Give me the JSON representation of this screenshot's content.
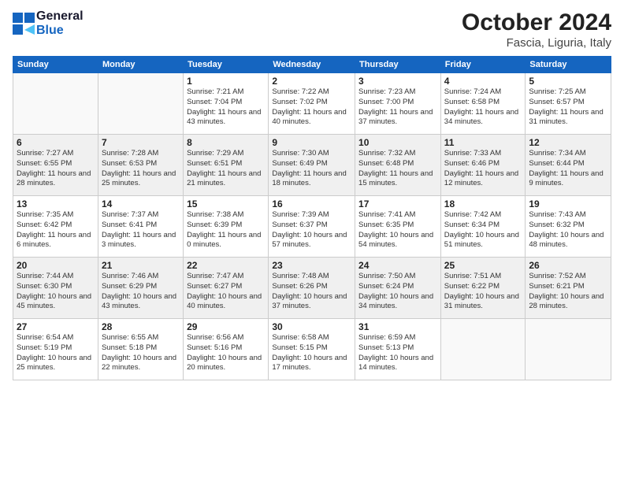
{
  "header": {
    "logo_line1": "General",
    "logo_line2": "Blue",
    "month": "October 2024",
    "location": "Fascia, Liguria, Italy"
  },
  "weekdays": [
    "Sunday",
    "Monday",
    "Tuesday",
    "Wednesday",
    "Thursday",
    "Friday",
    "Saturday"
  ],
  "weeks": [
    [
      {
        "day": "",
        "info": ""
      },
      {
        "day": "",
        "info": ""
      },
      {
        "day": "1",
        "info": "Sunrise: 7:21 AM\nSunset: 7:04 PM\nDaylight: 11 hours and 43 minutes."
      },
      {
        "day": "2",
        "info": "Sunrise: 7:22 AM\nSunset: 7:02 PM\nDaylight: 11 hours and 40 minutes."
      },
      {
        "day": "3",
        "info": "Sunrise: 7:23 AM\nSunset: 7:00 PM\nDaylight: 11 hours and 37 minutes."
      },
      {
        "day": "4",
        "info": "Sunrise: 7:24 AM\nSunset: 6:58 PM\nDaylight: 11 hours and 34 minutes."
      },
      {
        "day": "5",
        "info": "Sunrise: 7:25 AM\nSunset: 6:57 PM\nDaylight: 11 hours and 31 minutes."
      }
    ],
    [
      {
        "day": "6",
        "info": "Sunrise: 7:27 AM\nSunset: 6:55 PM\nDaylight: 11 hours and 28 minutes."
      },
      {
        "day": "7",
        "info": "Sunrise: 7:28 AM\nSunset: 6:53 PM\nDaylight: 11 hours and 25 minutes."
      },
      {
        "day": "8",
        "info": "Sunrise: 7:29 AM\nSunset: 6:51 PM\nDaylight: 11 hours and 21 minutes."
      },
      {
        "day": "9",
        "info": "Sunrise: 7:30 AM\nSunset: 6:49 PM\nDaylight: 11 hours and 18 minutes."
      },
      {
        "day": "10",
        "info": "Sunrise: 7:32 AM\nSunset: 6:48 PM\nDaylight: 11 hours and 15 minutes."
      },
      {
        "day": "11",
        "info": "Sunrise: 7:33 AM\nSunset: 6:46 PM\nDaylight: 11 hours and 12 minutes."
      },
      {
        "day": "12",
        "info": "Sunrise: 7:34 AM\nSunset: 6:44 PM\nDaylight: 11 hours and 9 minutes."
      }
    ],
    [
      {
        "day": "13",
        "info": "Sunrise: 7:35 AM\nSunset: 6:42 PM\nDaylight: 11 hours and 6 minutes."
      },
      {
        "day": "14",
        "info": "Sunrise: 7:37 AM\nSunset: 6:41 PM\nDaylight: 11 hours and 3 minutes."
      },
      {
        "day": "15",
        "info": "Sunrise: 7:38 AM\nSunset: 6:39 PM\nDaylight: 11 hours and 0 minutes."
      },
      {
        "day": "16",
        "info": "Sunrise: 7:39 AM\nSunset: 6:37 PM\nDaylight: 10 hours and 57 minutes."
      },
      {
        "day": "17",
        "info": "Sunrise: 7:41 AM\nSunset: 6:35 PM\nDaylight: 10 hours and 54 minutes."
      },
      {
        "day": "18",
        "info": "Sunrise: 7:42 AM\nSunset: 6:34 PM\nDaylight: 10 hours and 51 minutes."
      },
      {
        "day": "19",
        "info": "Sunrise: 7:43 AM\nSunset: 6:32 PM\nDaylight: 10 hours and 48 minutes."
      }
    ],
    [
      {
        "day": "20",
        "info": "Sunrise: 7:44 AM\nSunset: 6:30 PM\nDaylight: 10 hours and 45 minutes."
      },
      {
        "day": "21",
        "info": "Sunrise: 7:46 AM\nSunset: 6:29 PM\nDaylight: 10 hours and 43 minutes."
      },
      {
        "day": "22",
        "info": "Sunrise: 7:47 AM\nSunset: 6:27 PM\nDaylight: 10 hours and 40 minutes."
      },
      {
        "day": "23",
        "info": "Sunrise: 7:48 AM\nSunset: 6:26 PM\nDaylight: 10 hours and 37 minutes."
      },
      {
        "day": "24",
        "info": "Sunrise: 7:50 AM\nSunset: 6:24 PM\nDaylight: 10 hours and 34 minutes."
      },
      {
        "day": "25",
        "info": "Sunrise: 7:51 AM\nSunset: 6:22 PM\nDaylight: 10 hours and 31 minutes."
      },
      {
        "day": "26",
        "info": "Sunrise: 7:52 AM\nSunset: 6:21 PM\nDaylight: 10 hours and 28 minutes."
      }
    ],
    [
      {
        "day": "27",
        "info": "Sunrise: 6:54 AM\nSunset: 5:19 PM\nDaylight: 10 hours and 25 minutes."
      },
      {
        "day": "28",
        "info": "Sunrise: 6:55 AM\nSunset: 5:18 PM\nDaylight: 10 hours and 22 minutes."
      },
      {
        "day": "29",
        "info": "Sunrise: 6:56 AM\nSunset: 5:16 PM\nDaylight: 10 hours and 20 minutes."
      },
      {
        "day": "30",
        "info": "Sunrise: 6:58 AM\nSunset: 5:15 PM\nDaylight: 10 hours and 17 minutes."
      },
      {
        "day": "31",
        "info": "Sunrise: 6:59 AM\nSunset: 5:13 PM\nDaylight: 10 hours and 14 minutes."
      },
      {
        "day": "",
        "info": ""
      },
      {
        "day": "",
        "info": ""
      }
    ]
  ]
}
